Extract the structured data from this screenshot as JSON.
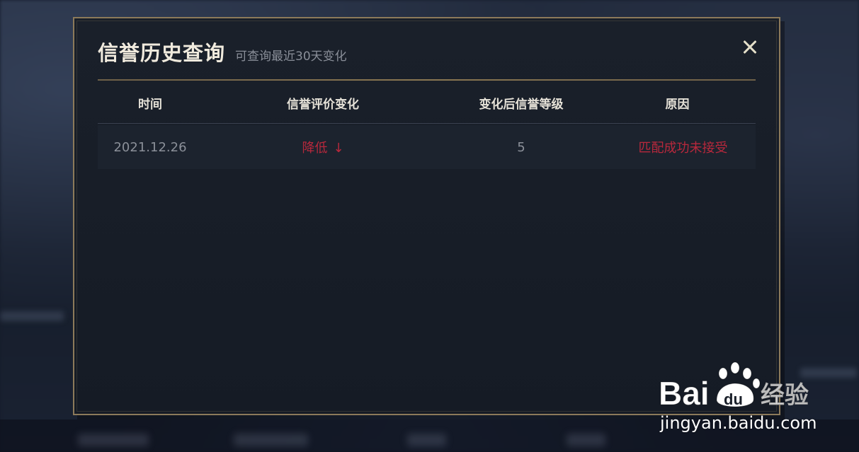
{
  "modal": {
    "title": "信誉历史查询",
    "subtitle": "可查询最近30天变化"
  },
  "table": {
    "headers": [
      "时间",
      "信誉评价变化",
      "变化后信誉等级",
      "原因"
    ],
    "rows": [
      {
        "time": "2021.12.26",
        "change": "降低",
        "change_arrow": "↓",
        "level": "5",
        "reason": "匹配成功未接受"
      }
    ]
  },
  "watermark": {
    "url": "jingyan.baidu.com"
  },
  "colors": {
    "accent_gold": "#8c7a5a",
    "decrease_red": "#b8283c",
    "title_text": "#f0eadd"
  },
  "icons": [
    "close-icon",
    "arrow-down-icon",
    "baidu-paw-icon"
  ]
}
